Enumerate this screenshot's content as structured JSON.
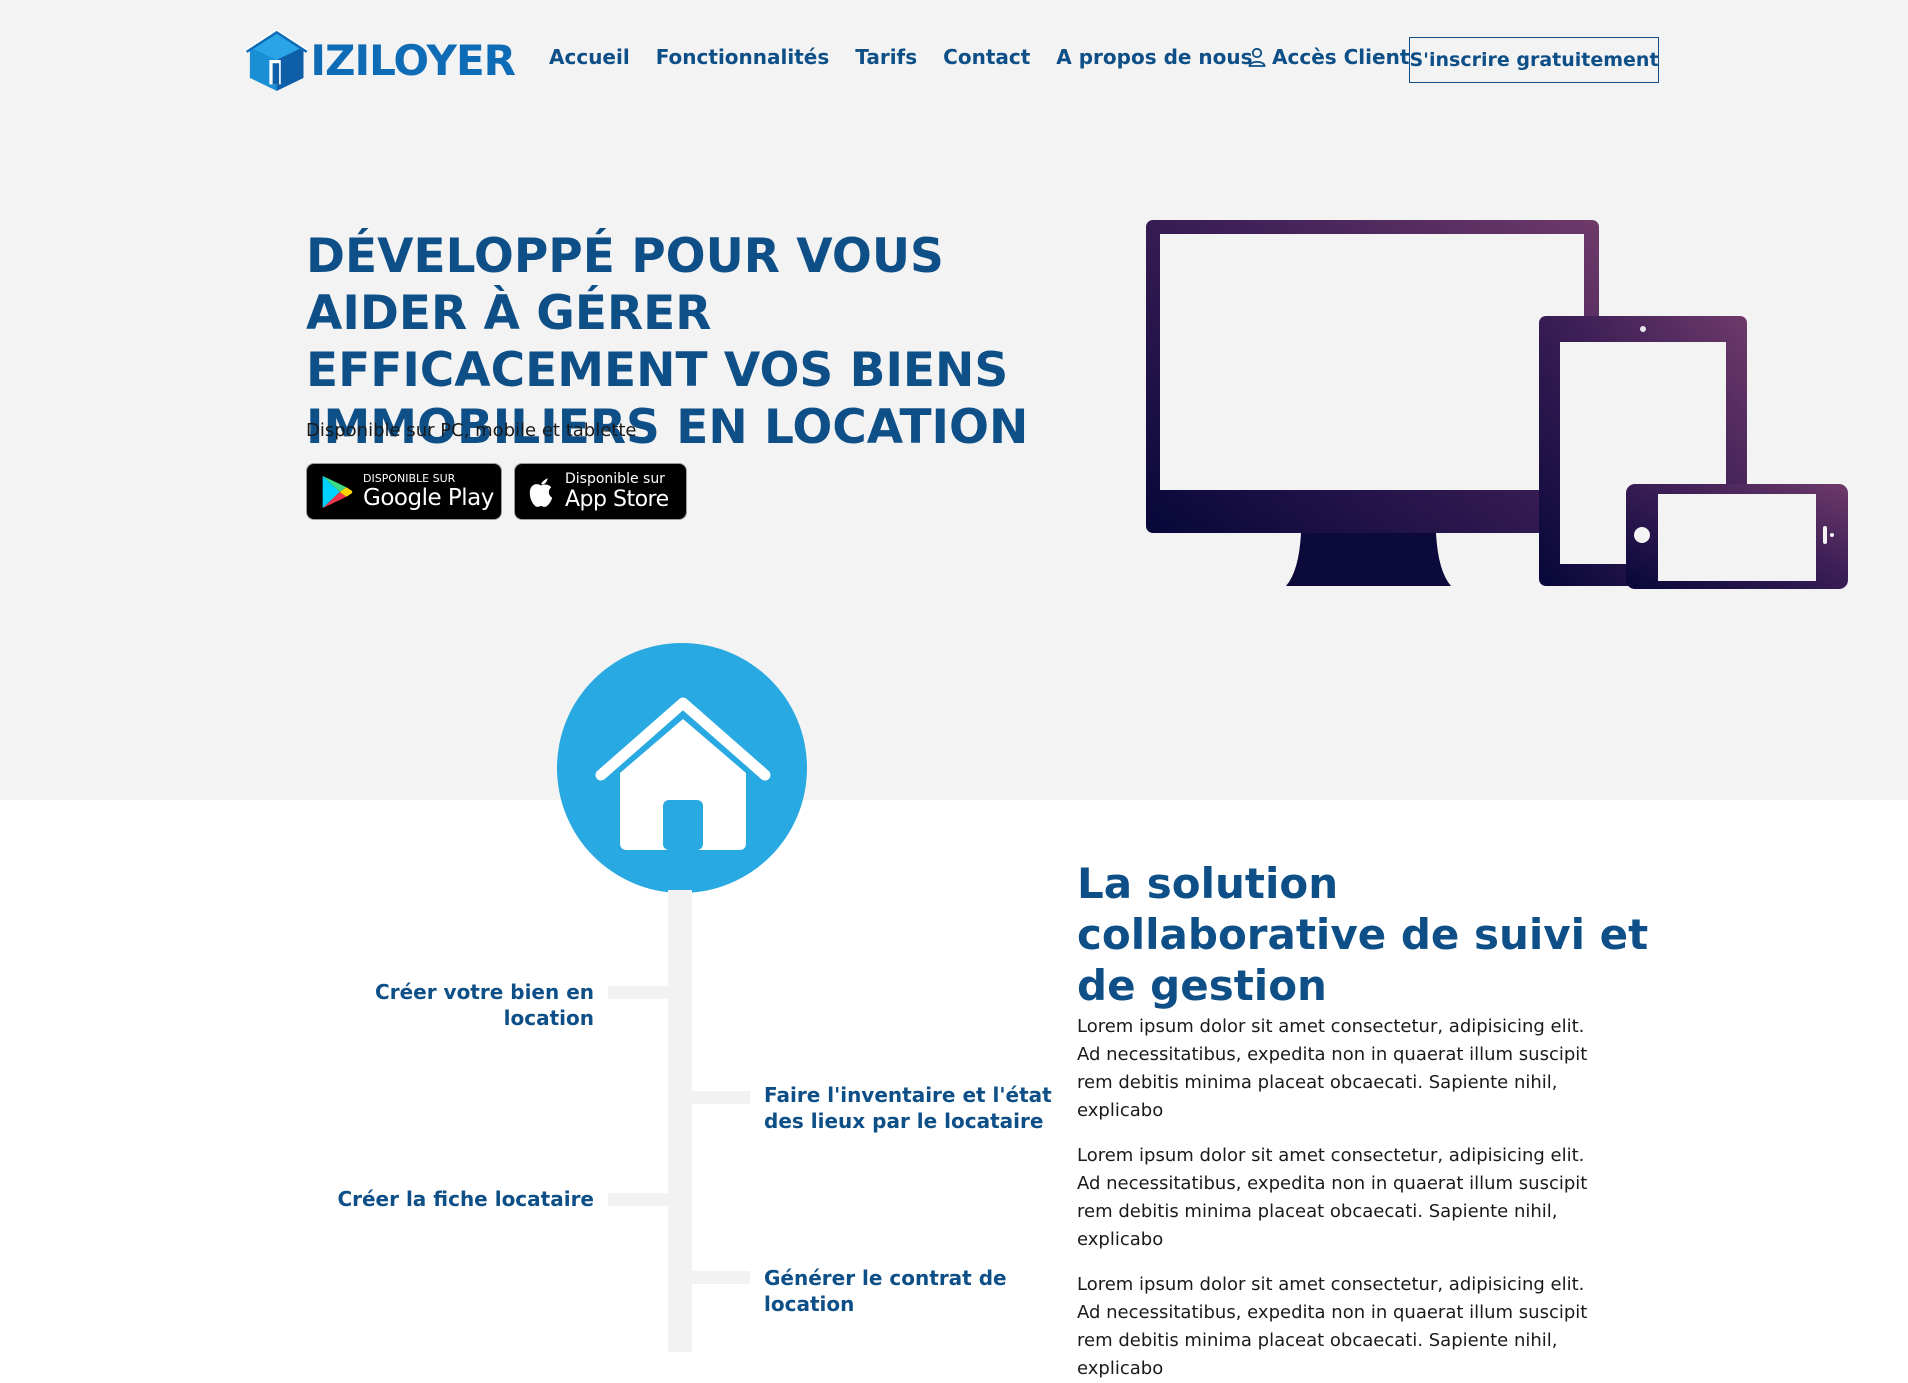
{
  "header": {
    "logo_text": "IZILOYER",
    "nav": [
      "Accueil",
      "Fonctionnalités",
      "Tarifs",
      "Contact",
      "A propos de nous"
    ],
    "client_label": "Accès Client",
    "signup_label": "S'inscrire gratuitement"
  },
  "hero": {
    "title": "DÉVELOPPÉ POUR VOUS AIDER À GÉRER EFFICACEMENT VOS BIENS IMMOBILIERS EN LOCATION",
    "subtitle": "Disponible sur PC, mobile et tablette",
    "google_play": {
      "small": "DISPONIBLE SUR",
      "big": "Google Play"
    },
    "app_store": {
      "small": "Disponible sur",
      "big": "App Store"
    }
  },
  "timeline": {
    "steps": [
      "Créer votre bien en location",
      "Faire l'inventaire et l'état des lieux par le locataire",
      "Créer la fiche locataire",
      "Générer le contrat de location"
    ]
  },
  "solution": {
    "title": "La solution collaborative de suivi et de gestion",
    "paragraphs": [
      "Lorem ipsum dolor sit amet consectetur, adipisicing elit. Ad necessitatibus, expedita non in quaerat illum suscipit rem debitis minima placeat obcaecati. Sapiente nihil, explicabo",
      "Lorem ipsum dolor sit amet consectetur, adipisicing elit. Ad necessitatibus, expedita non in quaerat illum suscipit rem debitis minima placeat obcaecati. Sapiente nihil, explicabo",
      "Lorem ipsum dolor sit amet consectetur, adipisicing elit. Ad necessitatibus, expedita non in quaerat illum suscipit rem debitis minima placeat obcaecati. Sapiente nihil, explicabo"
    ]
  },
  "colors": {
    "brand": "#0d4f86",
    "accent": "#29a9e1",
    "hero_bg": "#f3f3f4"
  }
}
